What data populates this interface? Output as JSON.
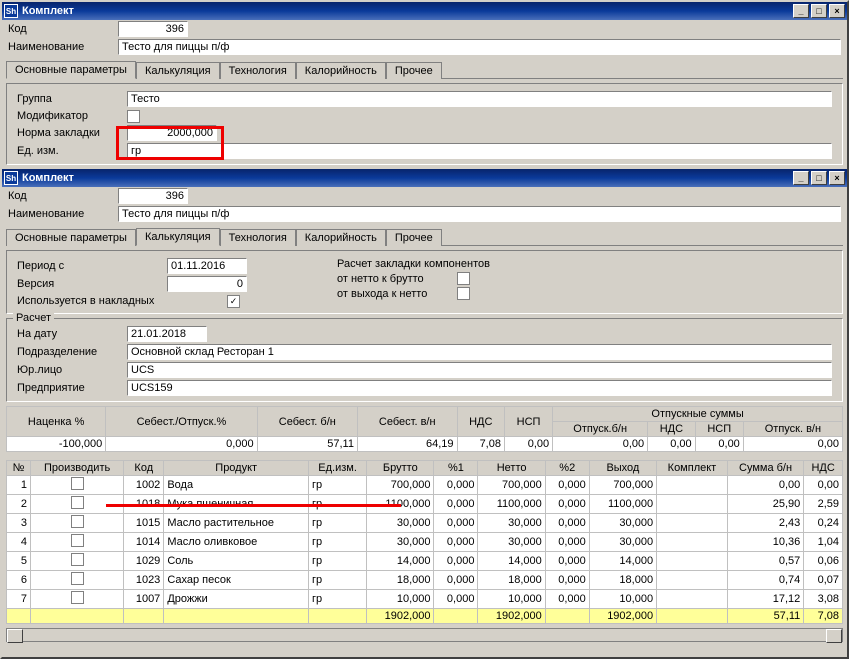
{
  "win1": {
    "title": "Комплект",
    "code_lbl": "Код",
    "code": "396",
    "name_lbl": "Наименование",
    "name": "Тесто для пиццы п/ф",
    "tabs": [
      "Основные параметры",
      "Калькуляция",
      "Технология",
      "Калорийность",
      "Прочее"
    ],
    "group_lbl": "Группа",
    "group": "Тесто",
    "mod_lbl": "Модификатор",
    "norm_lbl": "Норма закладки",
    "norm": "2000,000",
    "unit_lbl": "Ед. изм.",
    "unit": "гр"
  },
  "win2": {
    "title": "Комплект",
    "code_lbl": "Код",
    "code": "396",
    "name_lbl": "Наименование",
    "name": "Тесто для пиццы п/ф",
    "tabs": [
      "Основные параметры",
      "Калькуляция",
      "Технология",
      "Калорийность",
      "Прочее"
    ],
    "period_lbl": "Период с",
    "period": "01.11.2016",
    "ver_lbl": "Версия",
    "ver": "0",
    "used_lbl": "Используется в накладных",
    "used": "✓",
    "raschet_hdr": "Расчет закладки компонентов",
    "net_bru": "от нетто к брутто",
    "out_net": "от выхода к нетто",
    "grp_cap": "Расчет",
    "date_lbl": "На дату",
    "date": "21.01.2018",
    "dept_lbl": "Подразделение",
    "dept": "Основной склад Ресторан 1",
    "legal_lbl": "Юр.лицо",
    "legal": "UCS",
    "ent_lbl": "Предприятие",
    "ent": "UCS159",
    "sum_hdr": [
      "Наценка %",
      "Себест./Отпуск.%",
      "Себест. б/н",
      "Себест. в/н",
      "НДС",
      "НСП"
    ],
    "sum_hdr2_cap": "Отпускные суммы",
    "sum_hdr2": [
      "Отпуск.б/н",
      "НДС",
      "НСП",
      "Отпуск. в/н"
    ],
    "sum_vals": [
      "-100,000",
      "0,000",
      "57,11",
      "64,19",
      "7,08",
      "0,00",
      "0,00",
      "0,00",
      "0,00",
      "0,00"
    ],
    "cols": [
      "№",
      "Производить",
      "Код",
      "Продукт",
      "Ед.изм.",
      "Брутто",
      "%1",
      "Нетто",
      "%2",
      "Выход",
      "Комплект",
      "Сумма б/н",
      "НДС"
    ],
    "rows": [
      {
        "n": "1",
        "code": "1002",
        "prod": "Вода",
        "u": "гр",
        "b": "700,000",
        "p1": "0,000",
        "net": "700,000",
        "p2": "0,000",
        "out": "700,000",
        "k": "",
        "s": "0,00",
        "nds": "0,00"
      },
      {
        "n": "2",
        "code": "1018",
        "prod": "Мука пшеничная",
        "u": "гр",
        "b": "1100,000",
        "p1": "0,000",
        "net": "1100,000",
        "p2": "0,000",
        "out": "1100,000",
        "k": "",
        "s": "25,90",
        "nds": "2,59"
      },
      {
        "n": "3",
        "code": "1015",
        "prod": "Масло растительное",
        "u": "гр",
        "b": "30,000",
        "p1": "0,000",
        "net": "30,000",
        "p2": "0,000",
        "out": "30,000",
        "k": "",
        "s": "2,43",
        "nds": "0,24"
      },
      {
        "n": "4",
        "code": "1014",
        "prod": "Масло оливковое",
        "u": "гр",
        "b": "30,000",
        "p1": "0,000",
        "net": "30,000",
        "p2": "0,000",
        "out": "30,000",
        "k": "",
        "s": "10,36",
        "nds": "1,04"
      },
      {
        "n": "5",
        "code": "1029",
        "prod": "Соль",
        "u": "гр",
        "b": "14,000",
        "p1": "0,000",
        "net": "14,000",
        "p2": "0,000",
        "out": "14,000",
        "k": "",
        "s": "0,57",
        "nds": "0,06"
      },
      {
        "n": "6",
        "code": "1023",
        "prod": "Сахар песок",
        "u": "гр",
        "b": "18,000",
        "p1": "0,000",
        "net": "18,000",
        "p2": "0,000",
        "out": "18,000",
        "k": "",
        "s": "0,74",
        "nds": "0,07"
      },
      {
        "n": "7",
        "code": "1007",
        "prod": "Дрожжи",
        "u": "гр",
        "b": "10,000",
        "p1": "0,000",
        "net": "10,000",
        "p2": "0,000",
        "out": "10,000",
        "k": "",
        "s": "17,12",
        "nds": "3,08"
      }
    ],
    "totals": {
      "b": "1902,000",
      "net": "1902,000",
      "out": "1902,000",
      "s": "57,11",
      "nds": "7,08"
    }
  }
}
